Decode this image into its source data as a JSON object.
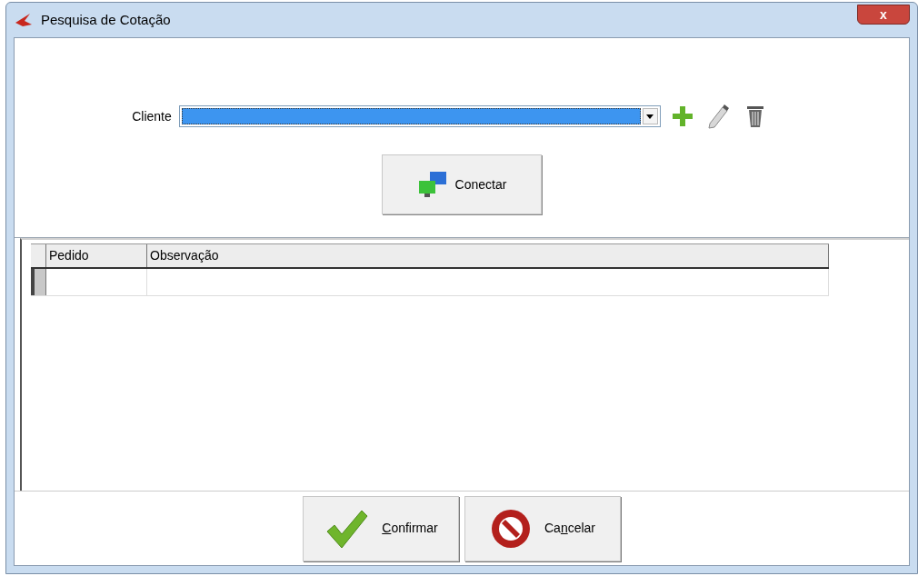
{
  "window": {
    "title": "Pesquisa de Cotação",
    "close": "x"
  },
  "client": {
    "label": "Cliente",
    "selected_text_highlighted": true
  },
  "connect_button": {
    "label": "Conectar"
  },
  "table": {
    "columns": [
      "Pedido",
      "Observação"
    ],
    "rows": [
      {
        "selected": true
      }
    ]
  },
  "buttons": [
    {
      "kind": "confirm",
      "access_key": "C",
      "label_rest": "onfirmar"
    },
    {
      "kind": "cancel",
      "label_start": "Ca",
      "access_key": "n",
      "label_rest": "celar"
    }
  ]
}
